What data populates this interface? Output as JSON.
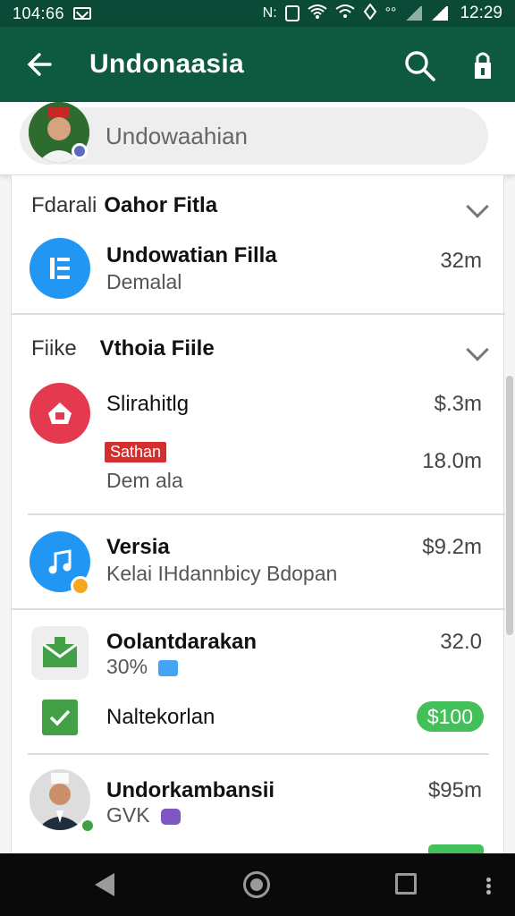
{
  "status_bar": {
    "time_left": "104:66",
    "network_label": "N:",
    "signal_text": "°°",
    "clock": "12:29"
  },
  "app_bar": {
    "title": "Undonaasia"
  },
  "search": {
    "placeholder": "Undowaahian"
  },
  "sections": [
    {
      "prefix": "Fdarali",
      "name": "Oahor Fitla",
      "items": [
        {
          "title": "Undowatian Filla",
          "subtitle": "Demalal",
          "amount": "32m",
          "icon": "list-icon",
          "color": "#2196f3"
        }
      ]
    },
    {
      "prefix": "Fiike",
      "name": "Vthoia Fiile",
      "items": [
        {
          "title": "Slirahitlg",
          "subtitle": "Dem ala",
          "amount": "$.3m",
          "amount2": "18.0m",
          "badge": "Sathan",
          "icon": "home-icon",
          "color": "#e53950"
        },
        {
          "title": "Versia",
          "subtitle": "Kelai IHdannbicy Bdopan",
          "amount": "$9.2m",
          "icon": "music-note-icon",
          "color": "#2196f3"
        },
        {
          "title": "Oolantdarakan",
          "subtitle": "30%",
          "amount": "32.0",
          "icon": "mail-icon",
          "color": "#43a047"
        },
        {
          "title": "Naltekorlan",
          "subtitle": "",
          "amount": "$100",
          "icon": "check-icon",
          "color": "#43a047"
        },
        {
          "title": "Undorkambansii",
          "subtitle": "GVK",
          "amount": "$95m",
          "icon": "person-icon",
          "color": "#555555"
        }
      ]
    }
  ],
  "colors": {
    "status_bar": "#0b4a36",
    "app_bar": "#0d5a41",
    "accent_green": "#43c059",
    "badge_red": "#d32f2f"
  }
}
